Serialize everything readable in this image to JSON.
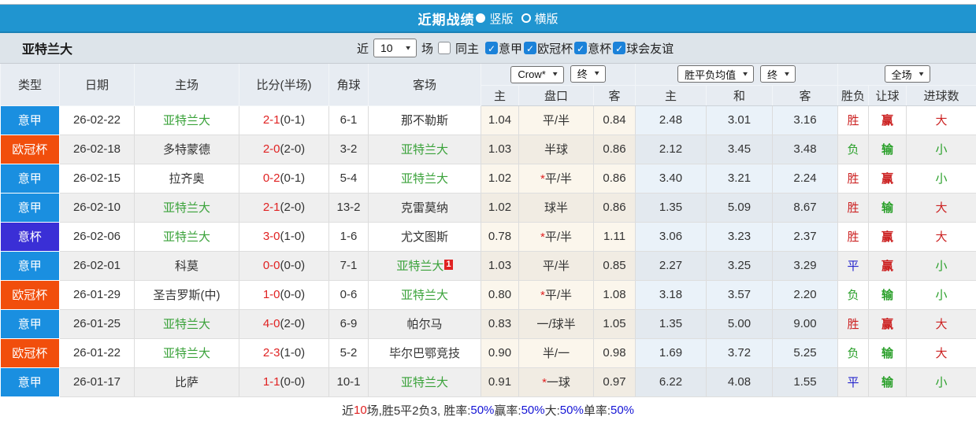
{
  "title_bar": {
    "title": "近期战绩",
    "options": [
      {
        "label": "竖版",
        "selected": true
      },
      {
        "label": "横版",
        "selected": false
      }
    ]
  },
  "toolbar": {
    "team": "亚特兰大",
    "recent_prefix": "近",
    "recent_count": "10",
    "recent_suffix": "场",
    "same_home": {
      "label": "同主",
      "checked": false
    },
    "league_filters": [
      {
        "label": "意甲",
        "checked": true
      },
      {
        "label": "欧冠杯",
        "checked": true
      },
      {
        "label": "意杯",
        "checked": true
      },
      {
        "label": "球会友谊",
        "checked": true
      }
    ]
  },
  "table": {
    "headers": {
      "type": "类型",
      "date": "日期",
      "home": "主场",
      "score": "比分(半场)",
      "corner": "角球",
      "away": "客场"
    },
    "selects": {
      "company": "Crow*",
      "company_time": "终",
      "avg": "胜平负均值",
      "avg_time": "终",
      "scope": "全场"
    },
    "subheaders": [
      "主",
      "盘口",
      "客",
      "主",
      "和",
      "客",
      "胜负",
      "让球",
      "进球数"
    ],
    "type_colors": {
      "意甲": "#1a8fe0",
      "欧冠杯": "#f14e0c",
      "意杯": "#3a2fd6"
    },
    "result_colors": {
      "red": "#cc2222",
      "green": "#2ba02b",
      "blue": "#2525cc"
    },
    "rows": [
      {
        "type": "意甲",
        "date": "26-02-22",
        "home": "亚特兰大",
        "home_team": true,
        "score_ft": "2-1",
        "score_ht": "(0-1)",
        "corner": "6-1",
        "away": "那不勒斯",
        "away_team": false,
        "away_badge": "",
        "odds_home": "1.04",
        "handicap": "平/半",
        "handicap_star": false,
        "odds_away": "0.84",
        "avg_home": "2.48",
        "avg_draw": "3.01",
        "avg_away": "3.16",
        "res_wdl": {
          "t": "胜",
          "c": "red"
        },
        "res_handicap": {
          "t": "赢",
          "c": "red"
        },
        "res_goals": {
          "t": "大",
          "c": "red"
        }
      },
      {
        "type": "欧冠杯",
        "date": "26-02-18",
        "home": "多特蒙德",
        "home_team": false,
        "score_ft": "2-0",
        "score_ht": "(2-0)",
        "corner": "3-2",
        "away": "亚特兰大",
        "away_team": true,
        "away_badge": "",
        "odds_home": "1.03",
        "handicap": "半球",
        "handicap_star": false,
        "odds_away": "0.86",
        "avg_home": "2.12",
        "avg_draw": "3.45",
        "avg_away": "3.48",
        "res_wdl": {
          "t": "负",
          "c": "green"
        },
        "res_handicap": {
          "t": "输",
          "c": "green"
        },
        "res_goals": {
          "t": "小",
          "c": "green"
        }
      },
      {
        "type": "意甲",
        "date": "26-02-15",
        "home": "拉齐奥",
        "home_team": false,
        "score_ft": "0-2",
        "score_ht": "(0-1)",
        "corner": "5-4",
        "away": "亚特兰大",
        "away_team": true,
        "away_badge": "",
        "odds_home": "1.02",
        "handicap": "平/半",
        "handicap_star": true,
        "odds_away": "0.86",
        "avg_home": "3.40",
        "avg_draw": "3.21",
        "avg_away": "2.24",
        "res_wdl": {
          "t": "胜",
          "c": "red"
        },
        "res_handicap": {
          "t": "赢",
          "c": "red"
        },
        "res_goals": {
          "t": "小",
          "c": "green"
        }
      },
      {
        "type": "意甲",
        "date": "26-02-10",
        "home": "亚特兰大",
        "home_team": true,
        "score_ft": "2-1",
        "score_ht": "(2-0)",
        "corner": "13-2",
        "away": "克雷莫纳",
        "away_team": false,
        "away_badge": "",
        "odds_home": "1.02",
        "handicap": "球半",
        "handicap_star": false,
        "odds_away": "0.86",
        "avg_home": "1.35",
        "avg_draw": "5.09",
        "avg_away": "8.67",
        "res_wdl": {
          "t": "胜",
          "c": "red"
        },
        "res_handicap": {
          "t": "输",
          "c": "green"
        },
        "res_goals": {
          "t": "大",
          "c": "red"
        }
      },
      {
        "type": "意杯",
        "date": "26-02-06",
        "home": "亚特兰大",
        "home_team": true,
        "score_ft": "3-0",
        "score_ht": "(1-0)",
        "corner": "1-6",
        "away": "尤文图斯",
        "away_team": false,
        "away_badge": "",
        "odds_home": "0.78",
        "handicap": "平/半",
        "handicap_star": true,
        "odds_away": "1.11",
        "avg_home": "3.06",
        "avg_draw": "3.23",
        "avg_away": "2.37",
        "res_wdl": {
          "t": "胜",
          "c": "red"
        },
        "res_handicap": {
          "t": "赢",
          "c": "red"
        },
        "res_goals": {
          "t": "大",
          "c": "red"
        }
      },
      {
        "type": "意甲",
        "date": "26-02-01",
        "home": "科莫",
        "home_team": false,
        "score_ft": "0-0",
        "score_ht": "(0-0)",
        "corner": "7-1",
        "away": "亚特兰大",
        "away_team": true,
        "away_badge": "1",
        "odds_home": "1.03",
        "handicap": "平/半",
        "handicap_star": false,
        "odds_away": "0.85",
        "avg_home": "2.27",
        "avg_draw": "3.25",
        "avg_away": "3.29",
        "res_wdl": {
          "t": "平",
          "c": "blue"
        },
        "res_handicap": {
          "t": "赢",
          "c": "red"
        },
        "res_goals": {
          "t": "小",
          "c": "green"
        }
      },
      {
        "type": "欧冠杯",
        "date": "26-01-29",
        "home": "圣吉罗斯(中)",
        "home_team": false,
        "score_ft": "1-0",
        "score_ht": "(0-0)",
        "corner": "0-6",
        "away": "亚特兰大",
        "away_team": true,
        "away_badge": "",
        "odds_home": "0.80",
        "handicap": "平/半",
        "handicap_star": true,
        "odds_away": "1.08",
        "avg_home": "3.18",
        "avg_draw": "3.57",
        "avg_away": "2.20",
        "res_wdl": {
          "t": "负",
          "c": "green"
        },
        "res_handicap": {
          "t": "输",
          "c": "green"
        },
        "res_goals": {
          "t": "小",
          "c": "green"
        }
      },
      {
        "type": "意甲",
        "date": "26-01-25",
        "home": "亚特兰大",
        "home_team": true,
        "score_ft": "4-0",
        "score_ht": "(2-0)",
        "corner": "6-9",
        "away": "帕尔马",
        "away_team": false,
        "away_badge": "",
        "odds_home": "0.83",
        "handicap": "一/球半",
        "handicap_star": false,
        "odds_away": "1.05",
        "avg_home": "1.35",
        "avg_draw": "5.00",
        "avg_away": "9.00",
        "res_wdl": {
          "t": "胜",
          "c": "red"
        },
        "res_handicap": {
          "t": "赢",
          "c": "red"
        },
        "res_goals": {
          "t": "大",
          "c": "red"
        }
      },
      {
        "type": "欧冠杯",
        "date": "26-01-22",
        "home": "亚特兰大",
        "home_team": true,
        "score_ft": "2-3",
        "score_ht": "(1-0)",
        "corner": "5-2",
        "away": "毕尔巴鄂竞技",
        "away_team": false,
        "away_badge": "",
        "odds_home": "0.90",
        "handicap": "半/一",
        "handicap_star": false,
        "odds_away": "0.98",
        "avg_home": "1.69",
        "avg_draw": "3.72",
        "avg_away": "5.25",
        "res_wdl": {
          "t": "负",
          "c": "green"
        },
        "res_handicap": {
          "t": "输",
          "c": "green"
        },
        "res_goals": {
          "t": "大",
          "c": "red"
        }
      },
      {
        "type": "意甲",
        "date": "26-01-17",
        "home": "比萨",
        "home_team": false,
        "score_ft": "1-1",
        "score_ht": "(0-0)",
        "corner": "10-1",
        "away": "亚特兰大",
        "away_team": true,
        "away_badge": "",
        "odds_home": "0.91",
        "handicap": "一球",
        "handicap_star": true,
        "odds_away": "0.97",
        "avg_home": "6.22",
        "avg_draw": "4.08",
        "avg_away": "1.55",
        "res_wdl": {
          "t": "平",
          "c": "blue"
        },
        "res_handicap": {
          "t": "输",
          "c": "green"
        },
        "res_goals": {
          "t": "小",
          "c": "green"
        }
      }
    ]
  },
  "footer": {
    "segments": [
      {
        "t": "近",
        "c": "#333333"
      },
      {
        "t": "10",
        "c": "#e02222"
      },
      {
        "t": "场,胜5平2负3, 胜率:",
        "c": "#333333"
      },
      {
        "t": "50%",
        "c": "#1515d6"
      },
      {
        "t": " 赢率:",
        "c": "#333333"
      },
      {
        "t": "50%",
        "c": "#1515d6"
      },
      {
        "t": " 大:",
        "c": "#333333"
      },
      {
        "t": "50%",
        "c": "#1515d6"
      },
      {
        "t": " 单率:",
        "c": "#333333"
      },
      {
        "t": "50%",
        "c": "#1515d6"
      }
    ]
  }
}
